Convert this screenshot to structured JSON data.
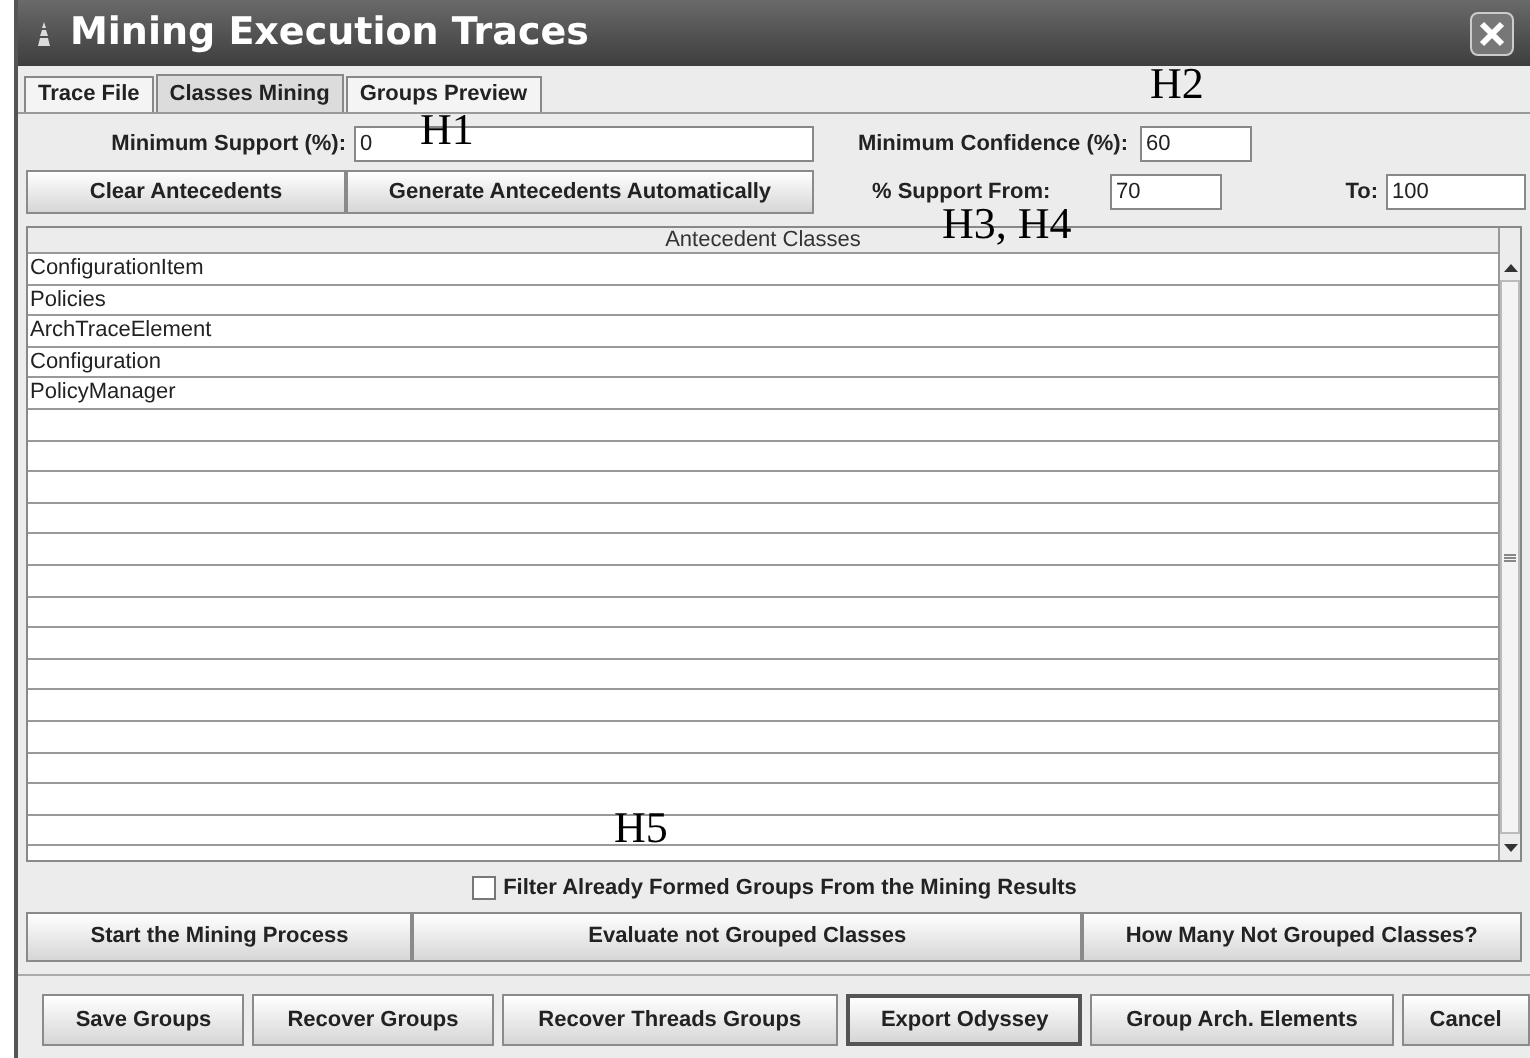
{
  "window": {
    "title": "Mining Execution Traces"
  },
  "tabs": [
    {
      "label": "Trace File",
      "selected": false
    },
    {
      "label": "Classes Mining",
      "selected": true
    },
    {
      "label": "Groups Preview",
      "selected": false
    }
  ],
  "min_support": {
    "label": "Minimum Support (%):",
    "value": "0"
  },
  "min_confidence": {
    "label": "Minimum Confidence (%):",
    "value": "60"
  },
  "support_from": {
    "label": "% Support From:",
    "value": "70"
  },
  "support_to": {
    "label": "To:",
    "value": "100"
  },
  "antecedent_buttons": [
    "Clear Antecedents",
    "Generate Antecedents Automatically"
  ],
  "table": {
    "columns": [
      "Antecedent Classes"
    ],
    "rows": [
      "ConfigurationItem",
      "Policies",
      "ArchTraceElement",
      "Configuration",
      "PolicyManager"
    ]
  },
  "filter": {
    "label": "Filter Already Formed Groups From the Mining Results",
    "checked": false
  },
  "mining_buttons": [
    "Start the Mining Process",
    "Evaluate not Grouped Classes",
    "How Many Not Grouped Classes?"
  ],
  "bottom_buttons": [
    {
      "label": "Save Groups",
      "selected": false
    },
    {
      "label": "Recover Groups",
      "selected": false
    },
    {
      "label": "Recover Threads Groups",
      "selected": false
    },
    {
      "label": "Export Odyssey",
      "selected": true
    },
    {
      "label": "Group Arch. Elements",
      "selected": false
    },
    {
      "label": "Cancel",
      "selected": false
    }
  ],
  "annotations": [
    "H1",
    "H2",
    "H3, H4",
    "H5"
  ]
}
